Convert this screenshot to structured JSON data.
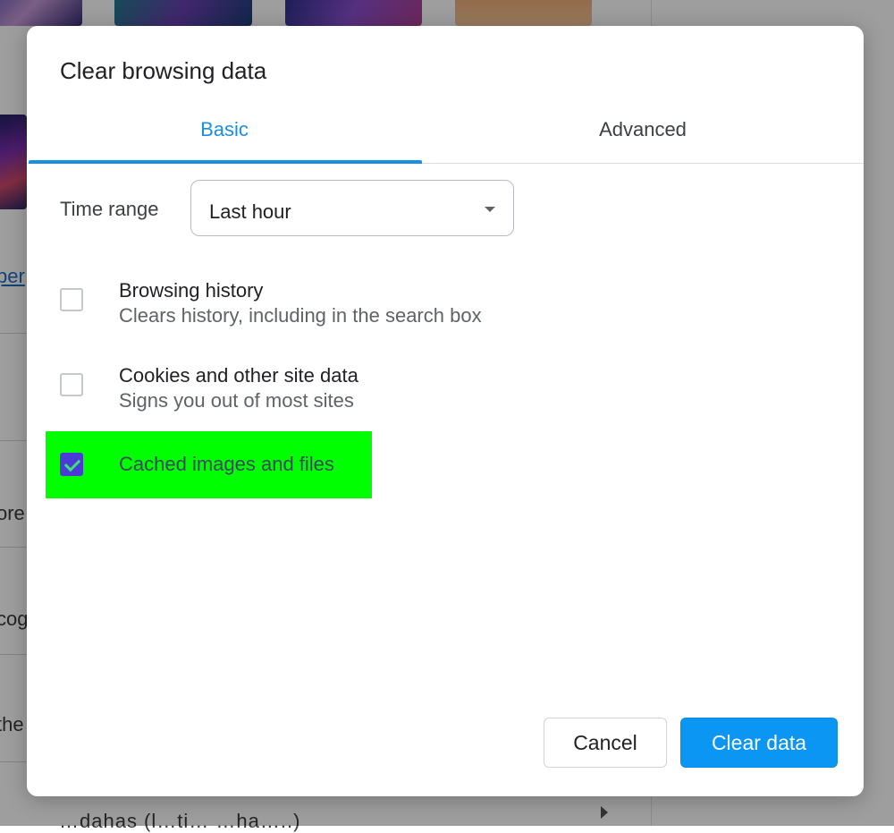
{
  "background": {
    "fragments": [
      "per",
      "ore",
      "cog",
      "the"
    ],
    "bottom_text": "…dahas (l…ti…                          …ha…..)"
  },
  "dialog": {
    "title": "Clear browsing data",
    "tabs": [
      {
        "label": "Basic",
        "selected": true
      },
      {
        "label": "Advanced",
        "selected": false
      }
    ],
    "time_range": {
      "label": "Time range",
      "selected": "Last hour"
    },
    "options": [
      {
        "title": "Browsing history",
        "description": "Clears history, including in the search box",
        "checked": false
      },
      {
        "title": "Cookies and other site data",
        "description": "Signs you out of most sites",
        "checked": false
      },
      {
        "title": "Cached images and files",
        "description": "",
        "checked": true
      }
    ],
    "buttons": {
      "cancel": "Cancel",
      "clear": "Clear data"
    }
  },
  "colors": {
    "accent": "#1a8fe0",
    "primary_button": "#0a96f2",
    "highlight": "#00ff00",
    "checkbox_checked": "#4b3bd6"
  }
}
